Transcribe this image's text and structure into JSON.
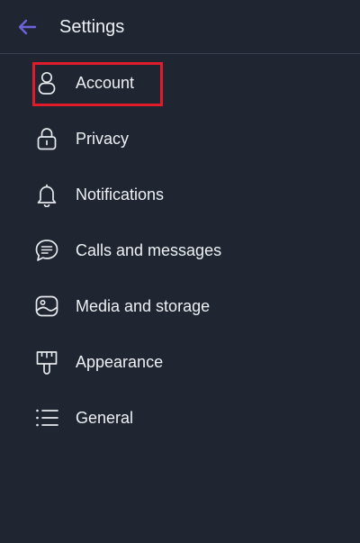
{
  "header": {
    "back_icon": "arrow-left-icon",
    "title": "Settings",
    "accent_color": "#6b63d8"
  },
  "menu": {
    "items": [
      {
        "label": "Account",
        "icon": "person-icon"
      },
      {
        "label": "Privacy",
        "icon": "lock-icon"
      },
      {
        "label": "Notifications",
        "icon": "bell-icon"
      },
      {
        "label": "Calls and messages",
        "icon": "chat-bubble-icon"
      },
      {
        "label": "Media and storage",
        "icon": "image-icon"
      },
      {
        "label": "Appearance",
        "icon": "paint-brush-icon"
      },
      {
        "label": "General",
        "icon": "list-icon"
      }
    ]
  },
  "highlight": {
    "target": "Account",
    "color": "#e01b2b"
  }
}
